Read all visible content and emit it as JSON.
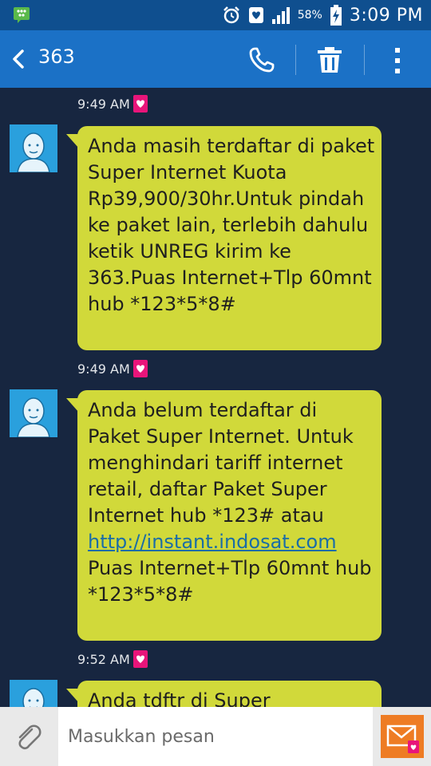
{
  "status_bar": {
    "battery_percent": "58%",
    "time": "3:09 PM"
  },
  "header": {
    "contact": "363"
  },
  "messages": [
    {
      "time": "9:49 AM",
      "text": "Anda masih terdaftar di paket Super Internet Kuota Rp39,900/30hr.Untuk pindah ke paket lain, terlebih dahulu ketik UNREG kirim ke 363.Puas Internet+Tlp 60mnt hub *123*5*8#"
    },
    {
      "time": "9:49 AM",
      "text_before_link": "Anda belum terdaftar di Paket Super Internet. Untuk menghindari tariff internet retail, daftar Paket Super Internet hub *123# atau ",
      "link": "http://instant.indosat.com",
      "text_after_link": " Puas Internet+Tlp 60mnt hub *123*5*8#"
    },
    {
      "time": "9:52 AM",
      "text": "Anda tdftr di Super"
    }
  ],
  "composer": {
    "placeholder": "Masukkan pesan"
  },
  "colors": {
    "status_bar": "#0f4f8f",
    "action_bar": "#1b71c6",
    "background": "#172640",
    "bubble": "#d1d93a",
    "send_button": "#ee7c24"
  }
}
